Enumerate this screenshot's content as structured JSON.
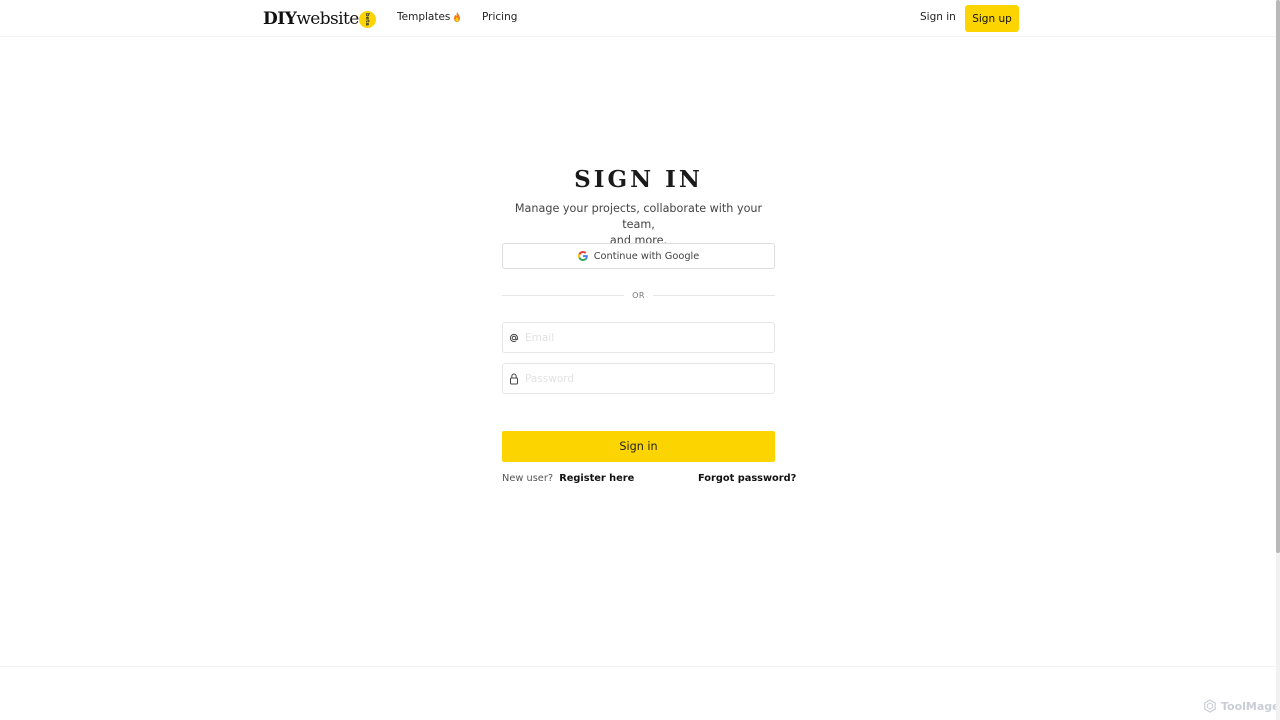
{
  "header": {
    "logo": {
      "part1": "DIY",
      "part2": "website",
      "badge": "beta"
    },
    "nav": {
      "templates": "Templates",
      "templates_icon": "flame-icon",
      "pricing": "Pricing"
    },
    "signin": "Sign in",
    "signup": "Sign up"
  },
  "main": {
    "title": "SIGN IN",
    "subtitle_line1": "Manage your projects, collaborate with your team,",
    "subtitle_line2": "and more.",
    "google_button": "Continue with Google",
    "divider": "OR",
    "email": {
      "placeholder": "Email",
      "value": "",
      "icon": "at-icon"
    },
    "password": {
      "placeholder": "Password",
      "value": "",
      "icon": "lock-icon"
    },
    "submit": "Sign in",
    "new_user": "New user?",
    "register": "Register here",
    "forgot": "Forgot password?"
  },
  "watermark": {
    "text": "ToolMage"
  },
  "colors": {
    "accent": "#fcd500",
    "background": "#ffffff",
    "text": "#1a1a1a"
  }
}
